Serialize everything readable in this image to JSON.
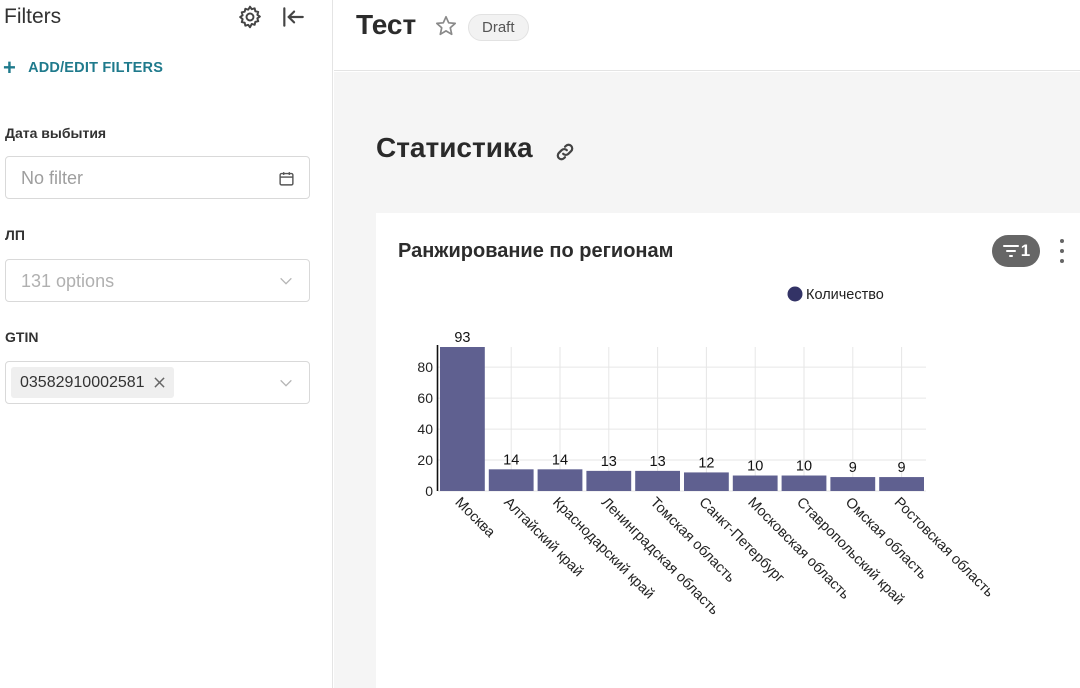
{
  "sidebar": {
    "title": "Filters",
    "add_filters_label": "ADD/EDIT FILTERS",
    "filters": [
      {
        "label": "Дата выбытия",
        "placeholder": "No filter"
      },
      {
        "label": "ЛП",
        "placeholder": "131 options"
      },
      {
        "label": "GTIN",
        "tag": "03582910002581"
      }
    ]
  },
  "header": {
    "title": "Тест",
    "status": "Draft"
  },
  "section": {
    "title": "Статистика"
  },
  "chart_card": {
    "title": "Ранжирование по регионам",
    "filter_count": "1"
  },
  "colors": {
    "bar": "#5f6090",
    "legend": "#333366",
    "accent": "#1f7a8c"
  },
  "chart_data": {
    "type": "bar",
    "title": "Ранжирование по регионам",
    "xlabel": "",
    "ylabel": "",
    "legend": [
      "Количество"
    ],
    "legend_position": "top",
    "categories": [
      "Москва",
      "Алтайский край",
      "Краснодарский край",
      "Ленинградская область",
      "Томская область",
      "Санкт-Петербург",
      "Московская область",
      "Ставропольский край",
      "Омская область",
      "Ростовская область"
    ],
    "series": [
      {
        "name": "Количество",
        "values": [
          93,
          14,
          14,
          13,
          13,
          12,
          10,
          10,
          9,
          9
        ]
      }
    ],
    "y_ticks": [
      0,
      20,
      40,
      60,
      80
    ],
    "ylim": [
      0,
      93
    ],
    "grid": true
  }
}
